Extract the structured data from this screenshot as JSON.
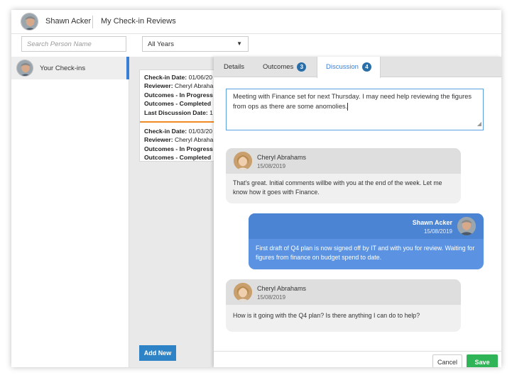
{
  "header": {
    "user_name": "Shawn Acker",
    "page_title": "My Check-in Reviews"
  },
  "filters": {
    "search_placeholder": "Search Person Name",
    "year_selected": "All Years",
    "year_caret": "▼"
  },
  "sidebar": {
    "items": [
      {
        "label": "Your Check-ins"
      }
    ]
  },
  "checkins": [
    {
      "date_label": "Check-in Date:",
      "date_value": "01/06/20",
      "reviewer_label": "Reviewer:",
      "reviewer_value": "Cheryl Abraha",
      "in_progress_label": "Outcomes - In Progress",
      "completed_label": "Outcomes - Completed",
      "last_discussion_label": "Last Discussion Date:",
      "last_discussion_value": "1"
    },
    {
      "date_label": "Check-in Date:",
      "date_value": "01/03/20",
      "reviewer_label": "Reviewer:",
      "reviewer_value": "Cheryl Abraha",
      "in_progress_label": "Outcomes - In Progress",
      "completed_label": "Outcomes - Completed"
    }
  ],
  "add_new_label": "Add New",
  "tabs": [
    {
      "label": "Details",
      "badge": ""
    },
    {
      "label": "Outcomes",
      "badge": "3"
    },
    {
      "label": "Discussion",
      "badge": "4"
    }
  ],
  "composer": {
    "text": "Meeting with Finance set for next Thursday. I may need help reviewing the figures from ops as there are some anomolies."
  },
  "messages": [
    {
      "author": "Cheryl Abrahams",
      "date": "15/08/2019",
      "text": "That's great. Initial comments willbe with you at the end of the week. Let me know how it goes with Finance.",
      "direction": "in"
    },
    {
      "author": "Shawn Acker",
      "date": "15/08/2019",
      "text": "First draft of Q4 plan is now signed off by IT and with you for review. Waiting for figures from finance on budget spend to date.",
      "direction": "out"
    },
    {
      "author": "Cheryl Abrahams",
      "date": "15/08/2019",
      "text": "How is it going with the Q4 plan? Is there anything I can do to help?",
      "direction": "in"
    }
  ],
  "actions": {
    "cancel_label": "Cancel",
    "save_label": "Save"
  },
  "colors": {
    "accent": "#3a7fd6",
    "badge": "#2a6ea8",
    "outgoing_bubble": "#5b93e2",
    "save": "#2fb457",
    "add_new": "#2e83c7",
    "card_separator": "#f08a24"
  }
}
